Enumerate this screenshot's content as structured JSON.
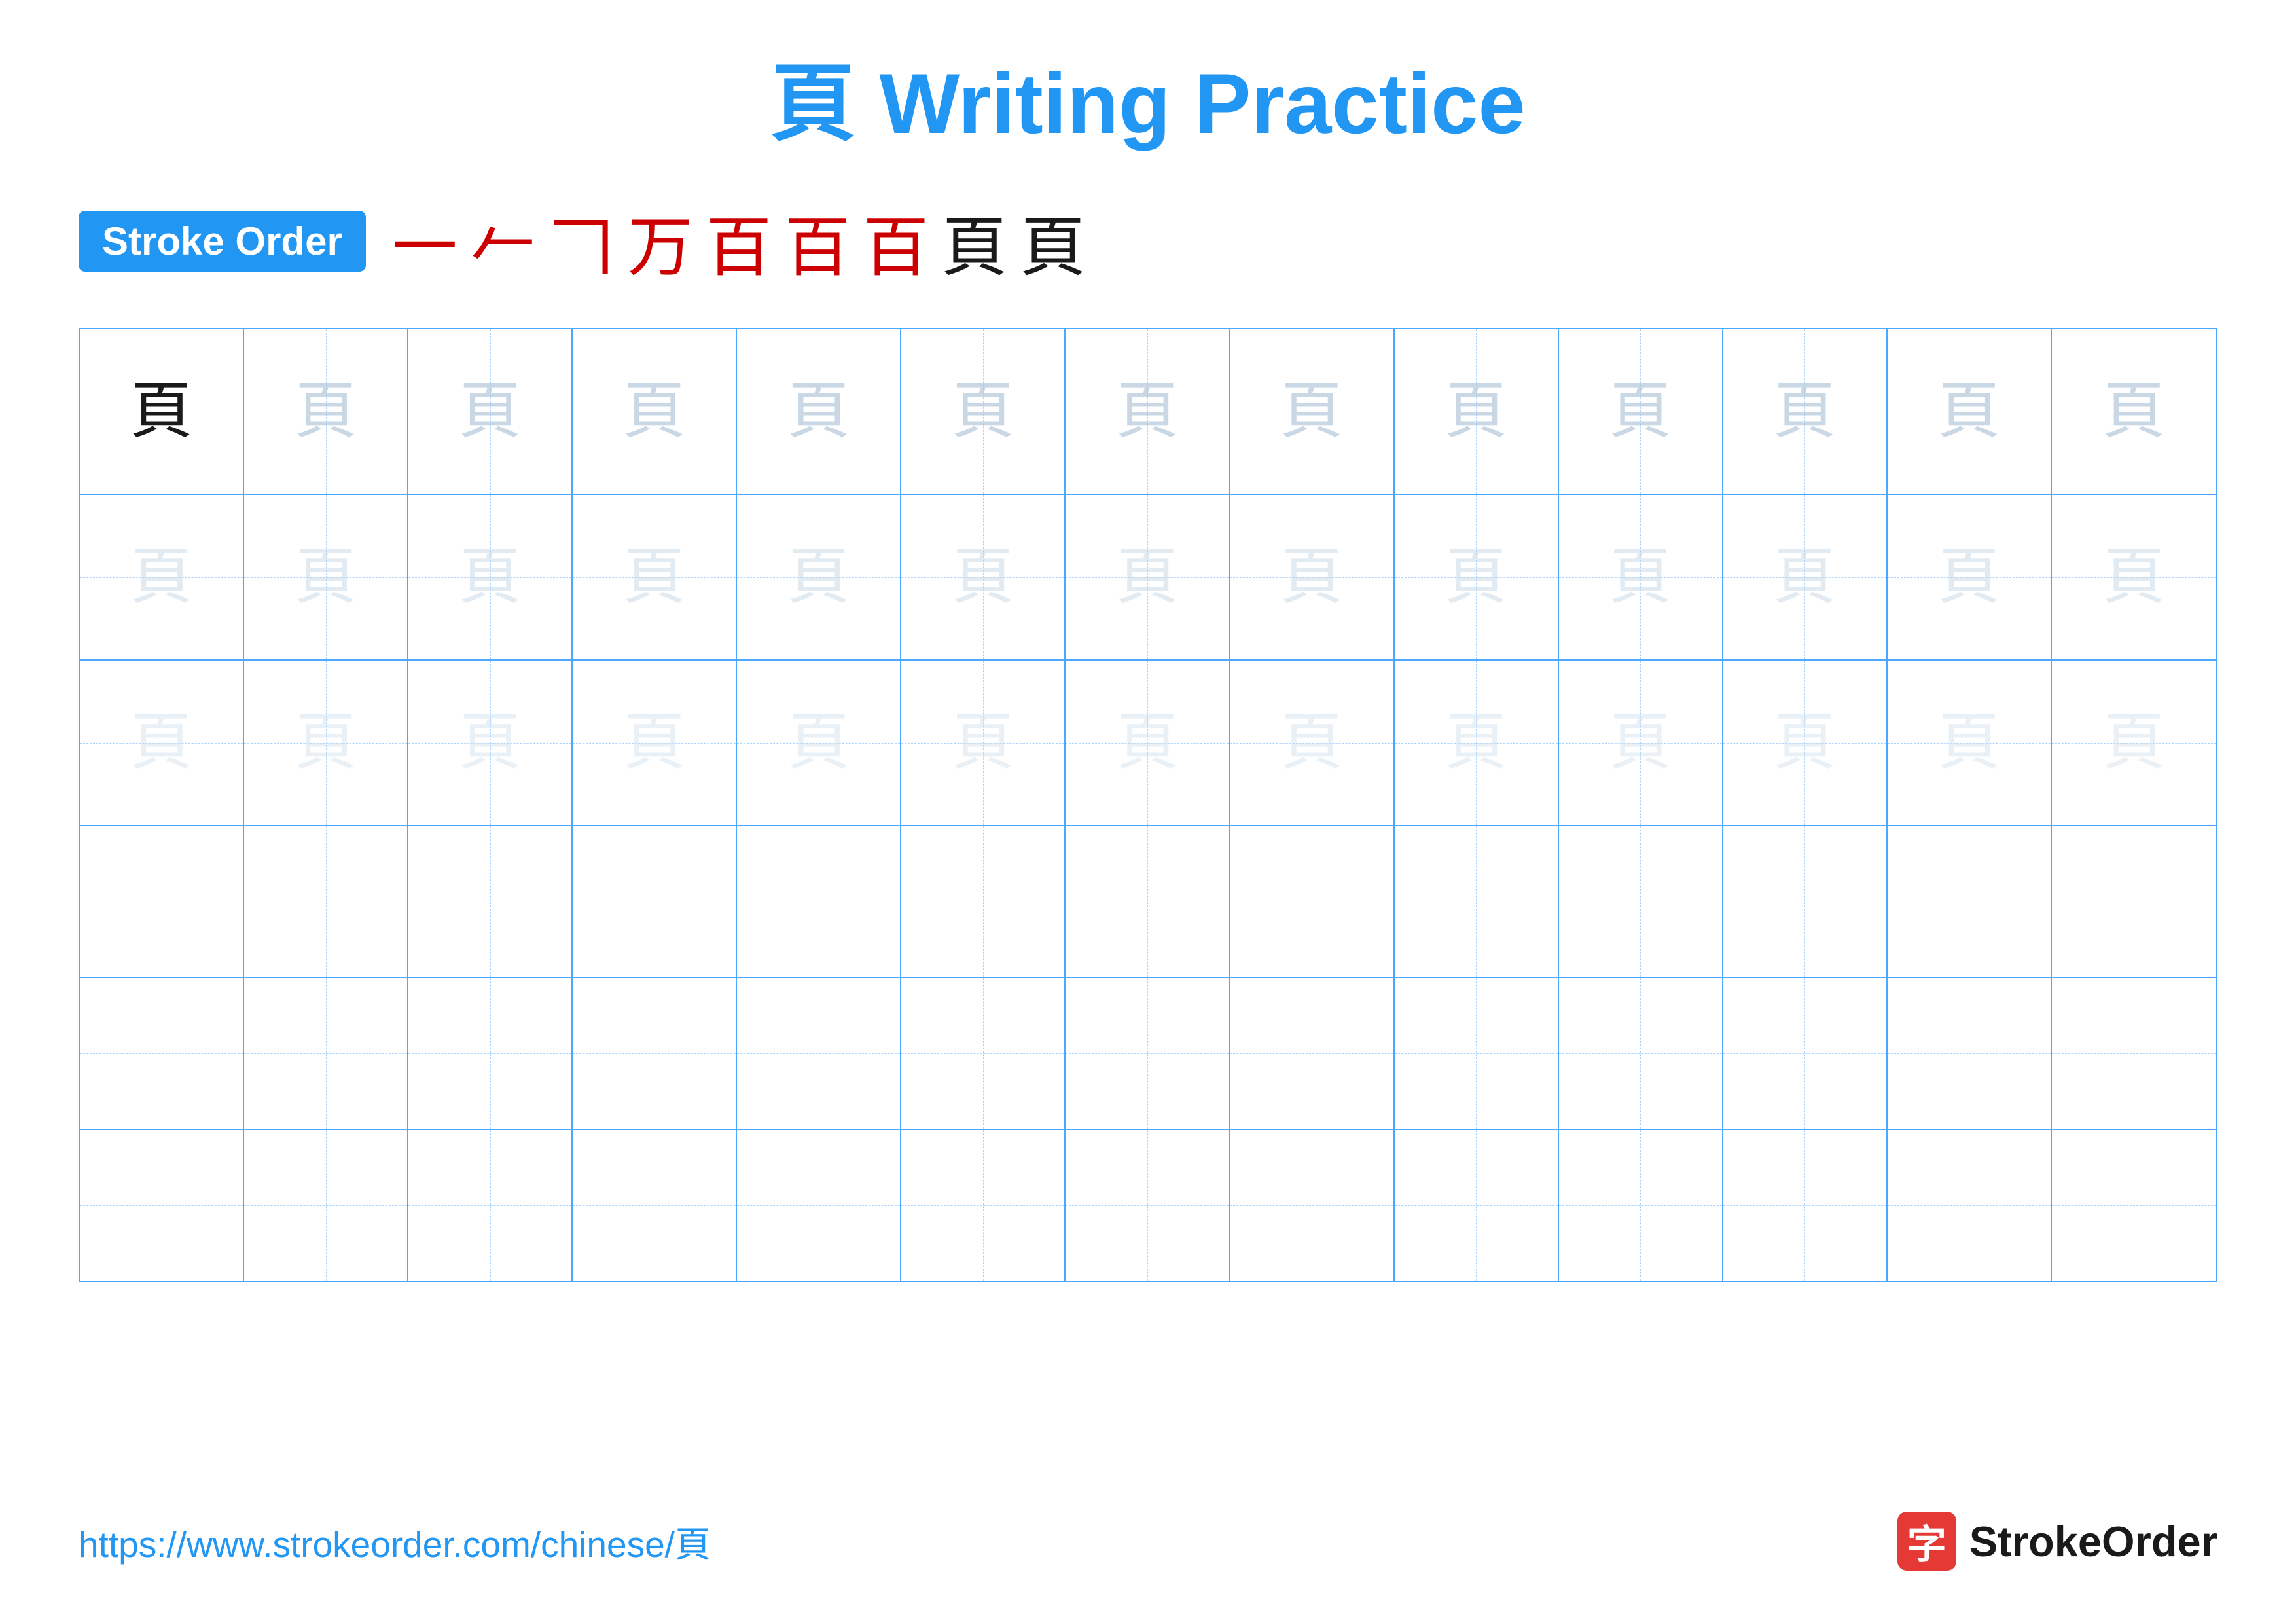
{
  "title": {
    "char": "頁",
    "text": " Writing Practice"
  },
  "stroke_order": {
    "badge_label": "Stroke Order",
    "strokes": [
      "一",
      "𠂉",
      "𠃍",
      "万",
      "百",
      "百",
      "百",
      "頁",
      "頁"
    ]
  },
  "grid": {
    "rows": 6,
    "cols": 13,
    "character": "頁"
  },
  "footer": {
    "url": "https://www.strokeorder.com/chinese/頁",
    "brand_name": "StrokeOrder",
    "brand_icon": "字"
  }
}
